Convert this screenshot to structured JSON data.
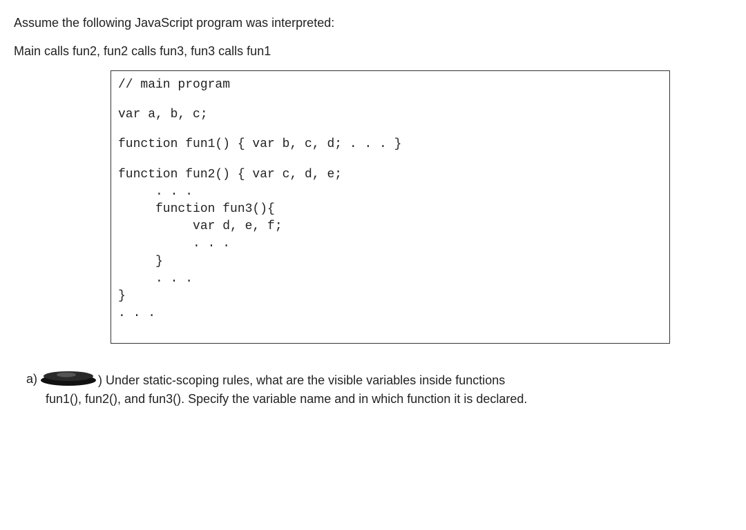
{
  "intro": {
    "line1": "Assume the following JavaScript program was interpreted:",
    "line2": "Main calls fun2, fun2 calls fun3, fun3 calls fun1"
  },
  "code": {
    "l1": "// main program",
    "l2": "var a, b, c;",
    "l3": "function fun1() { var b, c, d; . . . }",
    "l4": "function fun2() { var c, d, e;",
    "l5": "     . . .",
    "l6": "     function fun3(){",
    "l7": "          var d, e, f;",
    "l8": "          . . .",
    "l9": "     }",
    "l10": "     . . .",
    "l11": "}",
    "l12": ". . ."
  },
  "question": {
    "label": "a)",
    "paren_close": ")",
    "text_first": " Under static-scoping rules, what are the visible variables inside functions",
    "text_rest": "fun1(), fun2(), and fun3(). Specify the variable name and in which function it is declared."
  }
}
